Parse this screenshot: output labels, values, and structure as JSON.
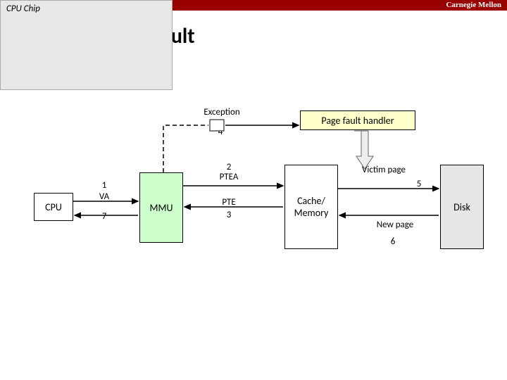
{
  "brand": "Carnegie Mellon",
  "title": "Last Time: Page Fault",
  "labels": {
    "exception": "Exception",
    "pfh": "Page fault handler",
    "cpu_chip": "CPU Chip",
    "cpu": "CPU",
    "mmu": "MMU",
    "cache_mem": "Cache/\nMemory",
    "disk": "Disk",
    "va": "VA",
    "ptea": "PTEA",
    "pte": "PTE",
    "victim": "Victim page",
    "newpage": "New page"
  },
  "steps": {
    "s1": "1",
    "s2": "2",
    "s3": "3",
    "s4": "4",
    "s5": "5",
    "s6": "6",
    "s7": "7"
  }
}
